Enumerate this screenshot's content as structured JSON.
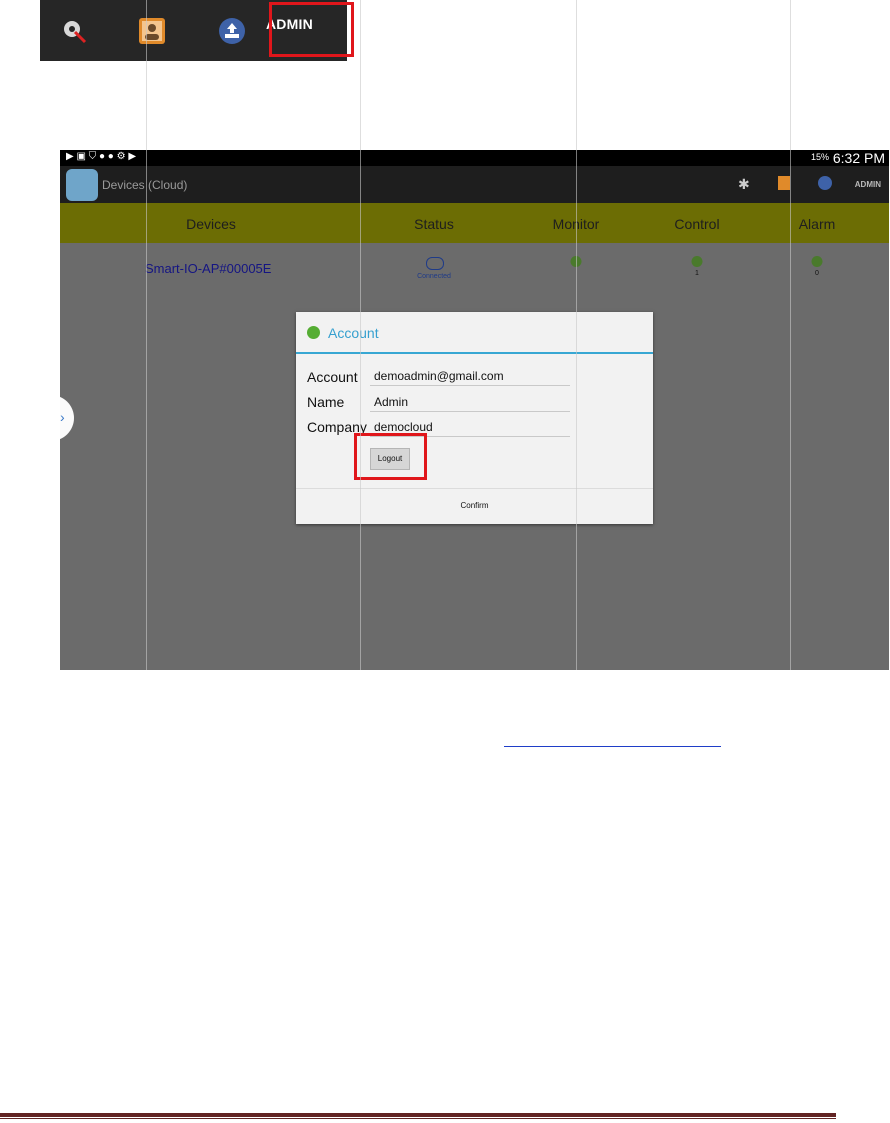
{
  "top_toolbar": {
    "admin_label": "ADMIN",
    "icons": [
      "settings-tools-icon",
      "user-profile-icon",
      "cloud-upload-icon"
    ]
  },
  "screenshot": {
    "status_bar": {
      "battery": "15%",
      "time": "6:32 PM"
    },
    "action_bar": {
      "title": "Devices (Cloud)",
      "admin_label": "ADMIN"
    },
    "table": {
      "columns": [
        "Devices",
        "Status",
        "Monitor",
        "Control",
        "Alarm"
      ],
      "row": {
        "device": "Smart-IO-AP#00005E",
        "status": "Connected",
        "control_count": "1",
        "alarm_count": "0"
      }
    },
    "dialog": {
      "title": "Account",
      "fields": [
        {
          "label": "Account",
          "value": "demoadmin@gmail.com"
        },
        {
          "label": "Name",
          "value": "Admin"
        },
        {
          "label": "Company",
          "value": "democloud"
        }
      ],
      "logout_label": "Logout",
      "confirm_label": "Confirm"
    }
  },
  "colors": {
    "highlight": "#e0161b",
    "header_row": "#6c6d04",
    "dialog_accent": "#36a0cf",
    "footer_rule": "#622423"
  }
}
